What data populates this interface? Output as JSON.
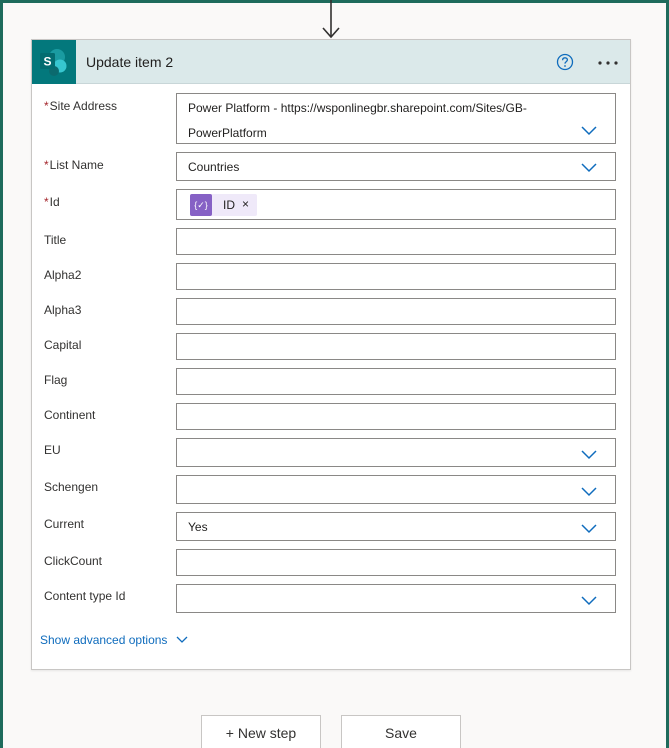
{
  "card": {
    "title": "Update item 2",
    "icon": "sharepoint-icon",
    "help_icon": "help-icon",
    "more_icon": "more-options-icon"
  },
  "fields": {
    "site_address": {
      "label": "Site Address",
      "required": "*",
      "value_line1": "Power Platform - https://wsponlinegbr.sharepoint.com/Sites/GB-",
      "value_line2": "PowerPlatform"
    },
    "list_name": {
      "label": "List Name",
      "required": "*",
      "value": "Countries"
    },
    "id": {
      "label": "Id",
      "required": "*",
      "token_label": "ID",
      "token_icon_text": "{✓}",
      "token_remove": "×"
    },
    "title": {
      "label": "Title",
      "value": ""
    },
    "alpha2": {
      "label": "Alpha2",
      "value": ""
    },
    "alpha3": {
      "label": "Alpha3",
      "value": ""
    },
    "capital": {
      "label": "Capital",
      "value": ""
    },
    "flag": {
      "label": "Flag",
      "value": ""
    },
    "continent": {
      "label": "Continent",
      "value": ""
    },
    "eu": {
      "label": "EU",
      "value": ""
    },
    "schengen": {
      "label": "Schengen",
      "value": ""
    },
    "current": {
      "label": "Current",
      "value": "Yes"
    },
    "clickcount": {
      "label": "ClickCount",
      "value": ""
    },
    "content_type_id": {
      "label": "Content type Id",
      "value": ""
    }
  },
  "advanced": {
    "label": "Show advanced options"
  },
  "footer": {
    "new_step": "+ New step",
    "save": "Save"
  },
  "colors": {
    "accent": "#0f6cbd",
    "header_bg": "#dbe9ea",
    "sharepoint": "#03787c",
    "token": "#8661c5",
    "required": "#a4262c",
    "frame": "#1e6b5c"
  }
}
